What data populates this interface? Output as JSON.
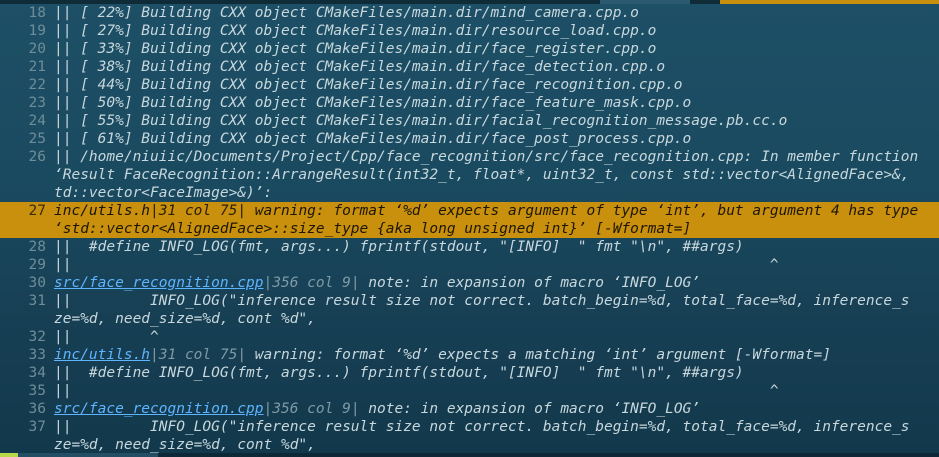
{
  "colors": {
    "background": "#1a4a60",
    "highlight": "#c8900c",
    "link": "#5fb4ff",
    "text": "#c7d7dc",
    "line_number": "#6f8d98"
  },
  "lines": [
    {
      "num": "18",
      "text": "|| [ 22%] Building CXX object CMakeFiles/main.dir/mind_camera.cpp.o"
    },
    {
      "num": "19",
      "text": "|| [ 27%] Building CXX object CMakeFiles/main.dir/resource_load.cpp.o"
    },
    {
      "num": "20",
      "text": "|| [ 33%] Building CXX object CMakeFiles/main.dir/face_register.cpp.o"
    },
    {
      "num": "21",
      "text": "|| [ 38%] Building CXX object CMakeFiles/main.dir/face_detection.cpp.o"
    },
    {
      "num": "22",
      "text": "|| [ 44%] Building CXX object CMakeFiles/main.dir/face_recognition.cpp.o"
    },
    {
      "num": "23",
      "text": "|| [ 50%] Building CXX object CMakeFiles/main.dir/face_feature_mask.cpp.o"
    },
    {
      "num": "24",
      "text": "|| [ 55%] Building CXX object CMakeFiles/main.dir/facial_recognition_message.pb.cc.o"
    },
    {
      "num": "25",
      "text": "|| [ 61%] Building CXX object CMakeFiles/main.dir/face_post_process.cpp.o"
    },
    {
      "num": "26",
      "text": "|| /home/niuiic/Documents/Project/Cpp/face_recognition/src/face_recognition.cpp: In member function"
    },
    {
      "num": "",
      "text": "‘Result FaceRecognition::ArrangeResult(int32_t, float*, uint32_t, const std::vector<AlignedFace>&,"
    },
    {
      "num": "",
      "text": "td::vector<FaceImage>&)’:"
    },
    {
      "num": "27",
      "file": "inc/utils.h",
      "pos": "|31 col 75|",
      "text": " warning: format ‘%d’ expects argument of type ‘int’, but argument 4 has type",
      "highlight": true
    },
    {
      "num": "",
      "text": "‘std::vector<AlignedFace>::size_type {aka long unsigned int}’ [-Wformat=]",
      "highlight": true
    },
    {
      "num": "28",
      "text": "||  #define INFO_LOG(fmt, args...) fprintf(stdout, \"[INFO]  \" fmt \"\\n\", ##args)"
    },
    {
      "num": "29",
      "text": "||                                                                                ^"
    },
    {
      "num": "30",
      "file": "src/face_recognition.cpp",
      "pos": "|356 col 9|",
      "text": " note: in expansion of macro ‘INFO_LOG’"
    },
    {
      "num": "31",
      "text": "||         INFO_LOG(\"inference result size not correct. batch_begin=%d, total_face=%d, inference_s"
    },
    {
      "num": "",
      "text": "ze=%d, need_size=%d, cont %d\","
    },
    {
      "num": "32",
      "text": "||         ^"
    },
    {
      "num": "33",
      "file": "inc/utils.h",
      "pos": "|31 col 75|",
      "text": " warning: format ‘%d’ expects a matching ‘int’ argument [-Wformat=]"
    },
    {
      "num": "34",
      "text": "||  #define INFO_LOG(fmt, args...) fprintf(stdout, \"[INFO]  \" fmt \"\\n\", ##args)"
    },
    {
      "num": "35",
      "text": "||                                                                                ^"
    },
    {
      "num": "36",
      "file": "src/face_recognition.cpp",
      "pos": "|356 col 9|",
      "text": " note: in expansion of macro ‘INFO_LOG’"
    },
    {
      "num": "37",
      "text": "||         INFO_LOG(\"inference result size not correct. batch_begin=%d, total_face=%d, inference_s"
    },
    {
      "num": "",
      "text": "ze=%d, need_size=%d, cont %d\","
    }
  ]
}
